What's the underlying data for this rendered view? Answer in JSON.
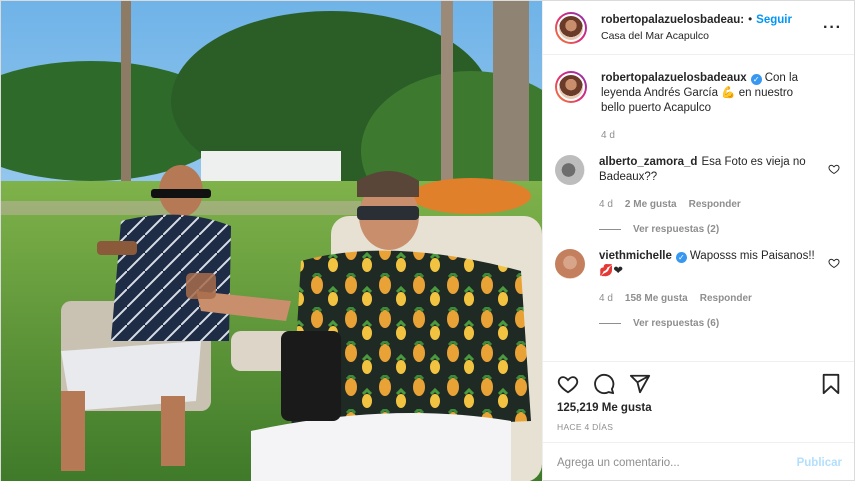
{
  "photo": {
    "alt": ""
  },
  "header": {
    "username": "robertopalazuelosbadeau:",
    "separator": "•",
    "follow_label": "Seguir",
    "location": "Casa del Mar Acapulco",
    "more_icon": "more-dots-icon"
  },
  "caption": {
    "username": "robertopalazuelosbadeaux",
    "text": "Con la leyenda Andrés García 💪 en nuestro bello puerto Acapulco",
    "time": "4 d"
  },
  "comments": [
    {
      "username": "alberto_zamora_d",
      "text": "Esa Foto es vieja no Badeaux??",
      "time": "4 d",
      "likes": "2 Me gusta",
      "reply_label": "Responder",
      "view_replies": "Ver respuestas (2)"
    },
    {
      "username": "viethmichelle",
      "text": "Waposss mis Paisanos!! 💋❤",
      "time": "4 d",
      "likes": "158 Me gusta",
      "reply_label": "Responder",
      "view_replies": "Ver respuestas (6)"
    }
  ],
  "actions": {
    "like_icon": "heart-icon",
    "comment_icon": "comment-icon",
    "share_icon": "send-icon",
    "save_icon": "bookmark-icon",
    "likes_count": "125,219 Me gusta",
    "posted_ago": "HACE 4 DÍAS"
  },
  "add_comment": {
    "placeholder": "Agrega un comentario...",
    "publish_label": "Publicar"
  },
  "colors": {
    "accent": "#0095f6",
    "publish_disabled": "#b2dffc",
    "verified": "#3897f0",
    "meta": "#8e8e8e",
    "border": "#efefef"
  }
}
